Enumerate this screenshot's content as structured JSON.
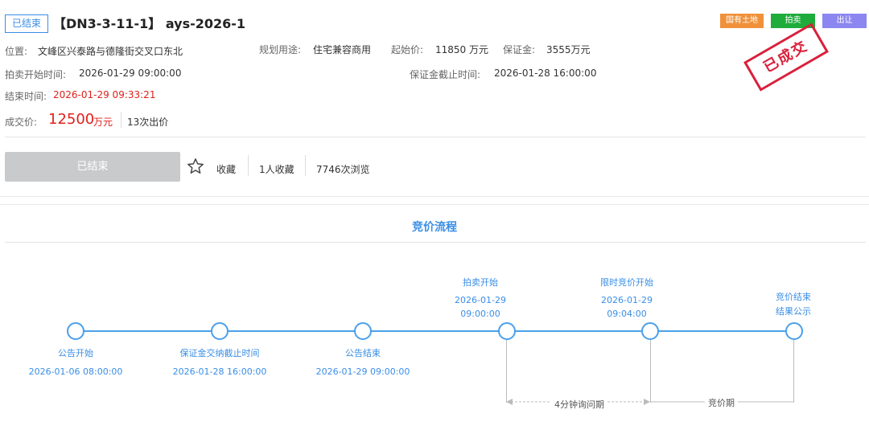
{
  "header": {
    "status": "已结束",
    "title": "【DN3-3-11-1】 ays-2026-1",
    "tags": [
      "国有土地",
      "拍卖",
      "出让"
    ],
    "stamp": "已成交"
  },
  "info": {
    "location_label": "位置:",
    "location_value": "文峰区兴泰路与德隆街交叉口东北",
    "usage_label": "规划用途:",
    "usage_value": "住宅兼容商用",
    "start_price_label": "起始价:",
    "start_price_value": "11850 万元",
    "deposit_label": "保证金:",
    "deposit_value": "3555万元",
    "auction_start_label": "拍卖开始时间:",
    "auction_start_value": "2026-01-29 09:00:00",
    "deposit_deadline_label": "保证金截止时间:",
    "deposit_deadline_value": "2026-01-28 16:00:00",
    "end_time_label": "结束时间:",
    "end_time_value": "2026-01-29 09:33:21",
    "deal_price_label": "成交价:",
    "deal_price_value": "12500",
    "deal_price_unit": "万元",
    "bid_count": "13次出价"
  },
  "actions": {
    "ended_button": "已结束",
    "favorite_label": "收藏",
    "favorites_count": "1人收藏",
    "views_count": "7746次浏览"
  },
  "process": {
    "title": "竞价流程",
    "below_nodes": [
      {
        "label": "公告开始",
        "date": "2026-01-06 08:00:00"
      },
      {
        "label": "保证金交纳截止时间",
        "date": "2026-01-28 16:00:00"
      },
      {
        "label": "公告结束",
        "date": "2026-01-29 09:00:00"
      }
    ],
    "above_nodes": [
      {
        "label": "拍卖开始",
        "date": "2026-01-29",
        "time": "09:00:00"
      },
      {
        "label": "限时竞价开始",
        "date": "2026-01-29",
        "time": "09:04:00"
      },
      {
        "label": "竞价结束",
        "label2": "结果公示"
      }
    ],
    "period_inquiry": "4分钟询问期",
    "period_bidding": "竞价期"
  },
  "colors": {
    "accent": "#3a8ee6",
    "deal_red": "#e0201b",
    "tag_land": "#f0913a",
    "tag_auction": "#1fac3b",
    "tag_sell": "#8c86f0"
  }
}
